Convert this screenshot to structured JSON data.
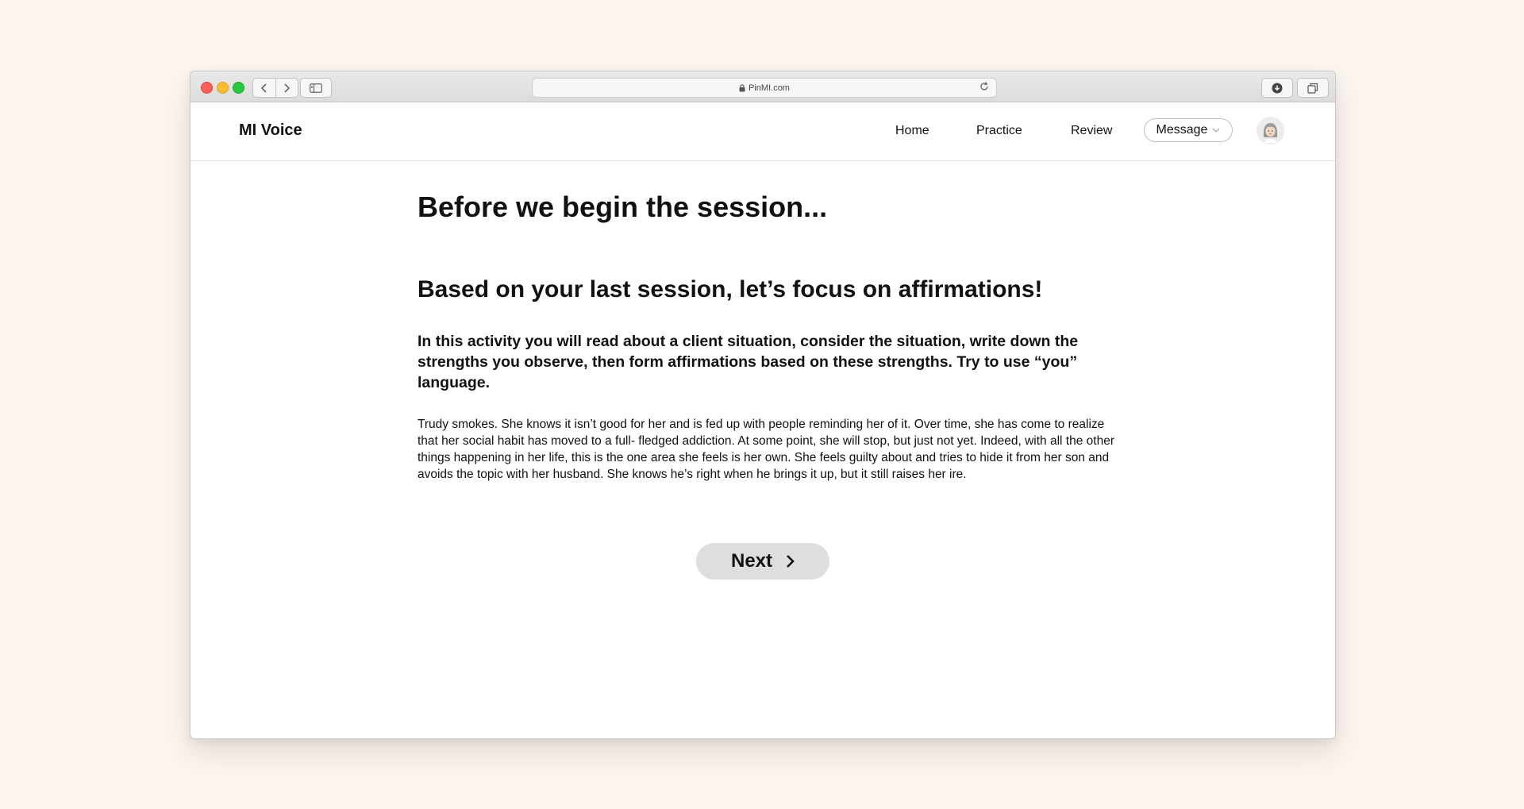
{
  "browser": {
    "url": "PinMI.com"
  },
  "header": {
    "brand": "MI Voice",
    "nav": {
      "home": "Home",
      "practice": "Practice",
      "review": "Review",
      "message": "Message"
    }
  },
  "main": {
    "title": "Before we begin the session...",
    "subtitle": "Based on your last session, let’s focus on affirmations!",
    "instructions": "In this activity you will read about a client situation, consider the situation, write down the strengths you observe, then form affirmations based on these strengths. Try to use “you” language.",
    "scenario": "Trudy smokes. She knows it isn’t good for her and is fed up with people reminding her of it. Over time, she has come to realize that her social habit has moved to a full- fledged addiction. At some point, she will stop, but just not yet. Indeed, with all the other things happening in her life, this is the one area she feels is her own. She feels guilty about and tries to hide it from her son and avoids the topic with her husband. She knows he’s right when he brings it up, but it still raises her ire.",
    "next_label": "Next"
  },
  "icons": {
    "back": "chevron-left-icon",
    "forward": "chevron-right-icon",
    "sidebar": "sidebar-icon",
    "lock": "lock-icon",
    "reload": "reload-icon",
    "download": "download-icon",
    "tabs": "tabs-icon",
    "message_dropdown": "chevron-down-icon",
    "avatar": "user-avatar-icon",
    "next": "chevron-right-icon"
  },
  "colors": {
    "page_background": "#fdf6f1",
    "window_background": "#ffffff",
    "button_background": "#dedede",
    "text": "#111111"
  }
}
